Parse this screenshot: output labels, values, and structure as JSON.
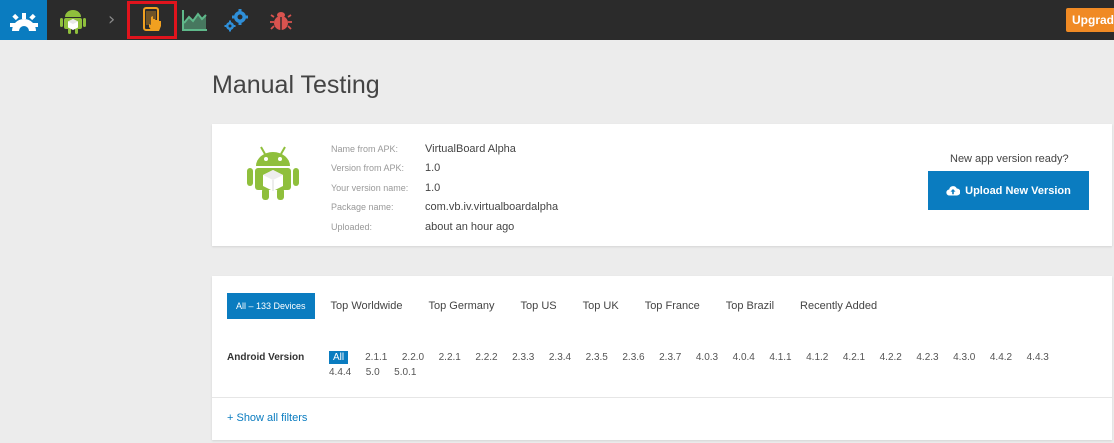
{
  "topbar": {
    "icons": {
      "logo": "gear-logo-icon",
      "app": "android-app-icon",
      "chevron": "›",
      "manual": "manual-testing-icon",
      "stats": "chart-icon",
      "settings": "gears-icon",
      "bug": "bug-icon"
    },
    "upgrade_label": "Upgrade"
  },
  "page": {
    "title": "Manual Testing"
  },
  "app": {
    "fields": [
      {
        "label": "Name from APK:",
        "value": "VirtualBoard Alpha"
      },
      {
        "label": "Version from APK:",
        "value": "1.0"
      },
      {
        "label": "Your version name:",
        "value": "1.0"
      },
      {
        "label": "Package name:",
        "value": "com.vb.iv.virtualboardalpha"
      },
      {
        "label": "Uploaded:",
        "value": "about an hour ago"
      }
    ],
    "ready_text": "New app version ready?",
    "upload_label": "Upload New Version"
  },
  "devices": {
    "tabs": [
      "All – 133 Devices",
      "Top Worldwide",
      "Top Germany",
      "Top US",
      "Top UK",
      "Top France",
      "Top Brazil",
      "Recently Added"
    ],
    "filter_label": "Android Version",
    "versions": [
      "All",
      "2.1.1",
      "2.2.0",
      "2.2.1",
      "2.2.2",
      "2.3.3",
      "2.3.4",
      "2.3.5",
      "2.3.6",
      "2.3.7",
      "4.0.3",
      "4.0.4",
      "4.1.1",
      "4.1.2",
      "4.2.1",
      "4.2.2",
      "4.2.3",
      "4.3.0",
      "4.4.2",
      "4.4.3",
      "4.4.4",
      "5.0",
      "5.0.1"
    ],
    "show_filters": "+ Show all filters"
  },
  "colors": {
    "accent": "#0a7cc0",
    "topbar": "#2b2b2b",
    "upgrade": "#f08a24",
    "highlight": "#e0141d"
  }
}
